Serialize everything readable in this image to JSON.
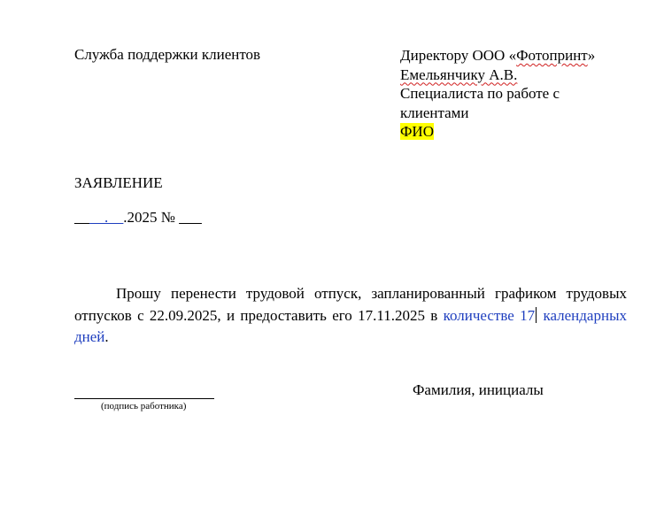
{
  "header": {
    "department": "Служба поддержки клиентов",
    "addressee": {
      "to_prefix": "Директору ООО «",
      "company": "Фотопринт",
      "to_suffix": "»",
      "director": "Емельянчику А.В.",
      "from_position_1": "Специалиста по работе с",
      "from_position_2": "клиентами",
      "from_name": "ФИО"
    }
  },
  "document": {
    "title": "ЗАЯВЛЕНИЕ",
    "date_day_blank": "__",
    "date_day_month": "__.__",
    "date_year": ".2025",
    "number_label": " № ",
    "number_blank": "___"
  },
  "body": {
    "text_main": "Прошу перенести трудовой отпуск, запланированный графиком трудовых отпусков с 22.09.2025, и предоставить его 17.11.2025 в ",
    "text_blue_1": "количестве 17",
    "text_blue_2": " календарных дней",
    "text_end": "."
  },
  "signature": {
    "caption": "(подпись работника)",
    "fullname_label": "Фамилия, инициалы"
  }
}
